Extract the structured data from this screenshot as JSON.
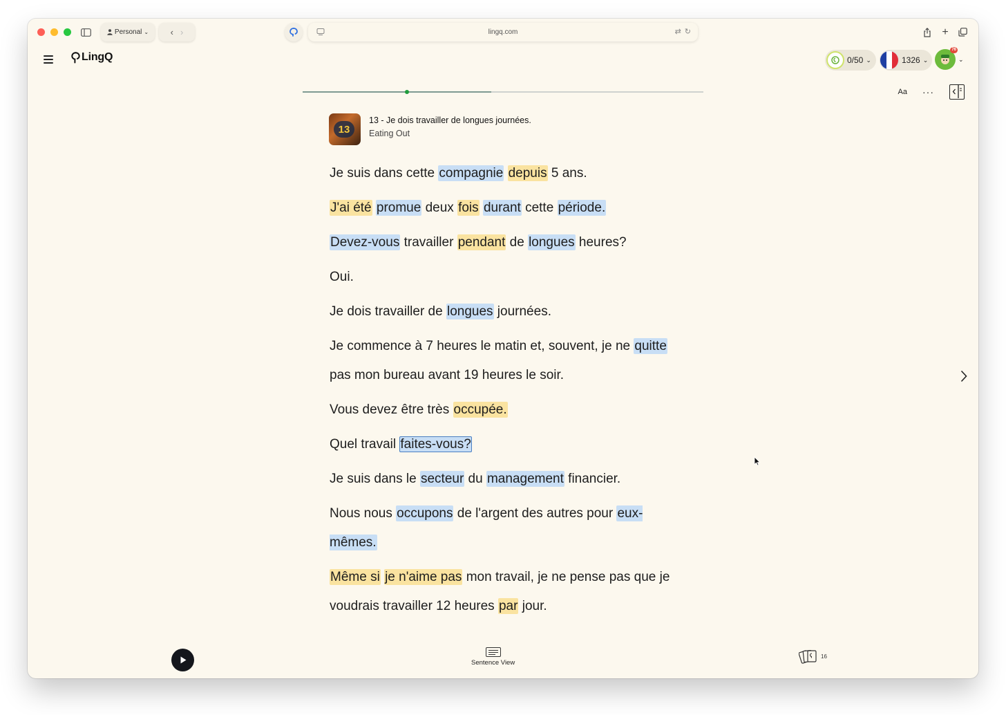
{
  "browser": {
    "profile_label": "Personal",
    "url": "lingq.com"
  },
  "header": {
    "logo_text": "LingQ",
    "daily_goal": "0/50",
    "known_words": "1326",
    "notification_count": "76",
    "language_flag": "france"
  },
  "reader": {
    "progress_percent": 47,
    "progress_marker_percent": 26,
    "font_button": "Aa",
    "more_button": "···",
    "lesson": {
      "thumbnail_number": "13",
      "title": "13 - Je dois travailler de longues journées.",
      "course": "Eating Out"
    },
    "paragraphs": [
      [
        {
          "t": "Je suis dans cette ",
          "s": "plain"
        },
        {
          "t": "compagnie",
          "s": "blue"
        },
        {
          "t": " ",
          "s": "plain"
        },
        {
          "t": "depuis",
          "s": "yellow"
        },
        {
          "t": " 5 ans.",
          "s": "plain"
        }
      ],
      [
        {
          "t": "J'ai été",
          "s": "yellow"
        },
        {
          "t": " ",
          "s": "plain"
        },
        {
          "t": "promue",
          "s": "blue"
        },
        {
          "t": " deux ",
          "s": "plain"
        },
        {
          "t": "fois",
          "s": "yellow"
        },
        {
          "t": " ",
          "s": "plain"
        },
        {
          "t": "durant",
          "s": "blue"
        },
        {
          "t": " cette ",
          "s": "plain"
        },
        {
          "t": "période.",
          "s": "blue"
        }
      ],
      [
        {
          "t": "Devez-vous",
          "s": "blue"
        },
        {
          "t": " travailler ",
          "s": "plain"
        },
        {
          "t": "pendant",
          "s": "yellow"
        },
        {
          "t": " de ",
          "s": "plain"
        },
        {
          "t": "longues",
          "s": "blue"
        },
        {
          "t": " heures?",
          "s": "plain"
        }
      ],
      [
        {
          "t": "Oui.",
          "s": "plain"
        }
      ],
      [
        {
          "t": "Je dois travailler de ",
          "s": "plain"
        },
        {
          "t": "longues",
          "s": "blue"
        },
        {
          "t": " journées.",
          "s": "plain"
        }
      ],
      [
        {
          "t": "Je commence à 7 heures le matin et, souvent, je ne ",
          "s": "plain"
        },
        {
          "t": "quitte",
          "s": "blue"
        },
        {
          "t": " pas mon bureau avant 19 heures le soir.",
          "s": "plain"
        }
      ],
      [
        {
          "t": "Vous devez être très ",
          "s": "plain"
        },
        {
          "t": "occupée.",
          "s": "yellow"
        }
      ],
      [
        {
          "t": "Quel travail ",
          "s": "plain"
        },
        {
          "t": "faites-vous?",
          "s": "selected"
        }
      ],
      [
        {
          "t": "Je suis dans le ",
          "s": "plain"
        },
        {
          "t": "secteur",
          "s": "blue"
        },
        {
          "t": " du ",
          "s": "plain"
        },
        {
          "t": "management",
          "s": "blue"
        },
        {
          "t": " financier.",
          "s": "plain"
        }
      ],
      [
        {
          "t": "Nous nous ",
          "s": "plain"
        },
        {
          "t": "occupons",
          "s": "blue"
        },
        {
          "t": " de l'argent des autres pour ",
          "s": "plain"
        },
        {
          "t": "eux-mêmes.",
          "s": "blue"
        }
      ],
      [
        {
          "t": "Même si",
          "s": "yellow"
        },
        {
          "t": " ",
          "s": "plain"
        },
        {
          "t": "je n'aime pas",
          "s": "yellow"
        },
        {
          "t": " mon travail, je ne pense pas que je voudrais travailler 12 heures ",
          "s": "plain"
        },
        {
          "t": "par",
          "s": "yellow"
        },
        {
          "t": " jour.",
          "s": "plain"
        }
      ]
    ]
  },
  "bottom_bar": {
    "sentence_view_label": "Sentence View",
    "cards_count": "16"
  },
  "colors": {
    "background": "#fcf8ee",
    "lingq_blue": "#c8def5",
    "lingq_yellow": "#fae3a0",
    "accent_green": "#1f9d3c"
  }
}
